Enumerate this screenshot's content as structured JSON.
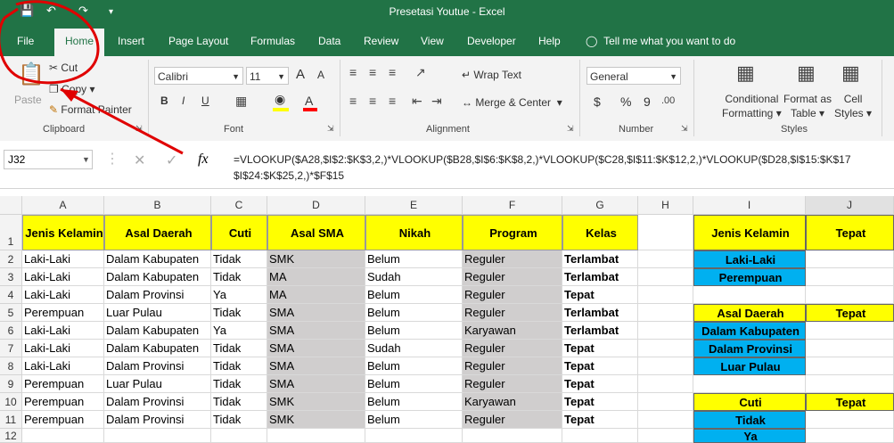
{
  "window": {
    "title": "Presetasi Youtue  -  Excel"
  },
  "tabs": [
    "File",
    "Home",
    "Insert",
    "Page Layout",
    "Formulas",
    "Data",
    "Review",
    "View",
    "Developer",
    "Help"
  ],
  "tell_me": "Tell me what you want to do",
  "ribbon": {
    "clipboard": {
      "paste": "Paste",
      "cut": "Cut",
      "copy": "Copy",
      "format_painter": "Format Painter",
      "label": "Clipboard"
    },
    "font": {
      "name": "Calibri",
      "size": "11",
      "bold": "B",
      "italic": "I",
      "underline": "U",
      "grow": "A",
      "shrink": "A",
      "label": "Font"
    },
    "alignment": {
      "wrap": "Wrap Text",
      "merge": "Merge & Center",
      "label": "Alignment"
    },
    "number": {
      "format": "General",
      "currency": "$",
      "percent": "%",
      "comma": "9",
      "label": "Number"
    },
    "styles": {
      "conditional1": "Conditional",
      "conditional2": "Formatting",
      "format_as1": "Format as",
      "format_as2": "Table",
      "cell1": "Cell",
      "cell2": "Styles",
      "label": "Styles"
    }
  },
  "formula_bar": {
    "name_box": "J32",
    "fx": "fx",
    "formula": "=VLOOKUP($A28,$I$2:$K$3,2,)*VLOOKUP($B28,$I$6:$K$8,2,)*VLOOKUP($C28,$I$11:$K$12,2,)*VLOOKUP($D28,$I$15:$K$17\n$I$24:$K$25,2,)*$F$15"
  },
  "columns": [
    "A",
    "B",
    "C",
    "D",
    "E",
    "F",
    "G",
    "H",
    "I",
    "J"
  ],
  "headers": [
    "Jenis Kelamin",
    "Asal Daerah",
    "Cuti",
    "Asal SMA",
    "Nikah",
    "Program",
    "Kelas"
  ],
  "rows": [
    [
      "Laki-Laki",
      "Dalam Kabupaten",
      "Tidak",
      "SMK",
      "Belum",
      "Reguler",
      "Terlambat"
    ],
    [
      "Laki-Laki",
      "Dalam Kabupaten",
      "Tidak",
      "MA",
      "Sudah",
      "Reguler",
      "Terlambat"
    ],
    [
      "Laki-Laki",
      "Dalam Provinsi",
      "Ya",
      "MA",
      "Belum",
      "Reguler",
      "Tepat"
    ],
    [
      "Perempuan",
      "Luar Pulau",
      "Tidak",
      "SMA",
      "Belum",
      "Reguler",
      "Terlambat"
    ],
    [
      "Laki-Laki",
      "Dalam Kabupaten",
      "Ya",
      "SMA",
      "Belum",
      "Karyawan",
      "Terlambat"
    ],
    [
      "Laki-Laki",
      "Dalam Kabupaten",
      "Tidak",
      "SMA",
      "Sudah",
      "Reguler",
      "Tepat"
    ],
    [
      "Laki-Laki",
      "Dalam Provinsi",
      "Tidak",
      "SMA",
      "Belum",
      "Reguler",
      "Tepat"
    ],
    [
      "Perempuan",
      "Luar Pulau",
      "Tidak",
      "SMA",
      "Belum",
      "Reguler",
      "Tepat"
    ],
    [
      "Perempuan",
      "Dalam Provinsi",
      "Tidak",
      "SMK",
      "Belum",
      "Karyawan",
      "Tepat"
    ],
    [
      "Perempuan",
      "Dalam Provinsi",
      "Tidak",
      "SMK",
      "Belum",
      "Reguler",
      "Tepat"
    ]
  ],
  "side": {
    "h1": "Jenis Kelamin",
    "h1j": "Tepat",
    "laki": "Laki-Laki",
    "perempuan": "Perempuan",
    "h2": "Asal Daerah",
    "h2j": "Tepat",
    "dk": "Dalam Kabupaten",
    "dp": "Dalam Provinsi",
    "lp": "Luar Pulau",
    "h3": "Cuti",
    "h3j": "Tepat",
    "tidak": "Tidak",
    "ya": "Ya"
  },
  "row_numbers": [
    "1",
    "2",
    "3",
    "4",
    "5",
    "6",
    "7",
    "8",
    "9",
    "10",
    "11",
    "12"
  ]
}
